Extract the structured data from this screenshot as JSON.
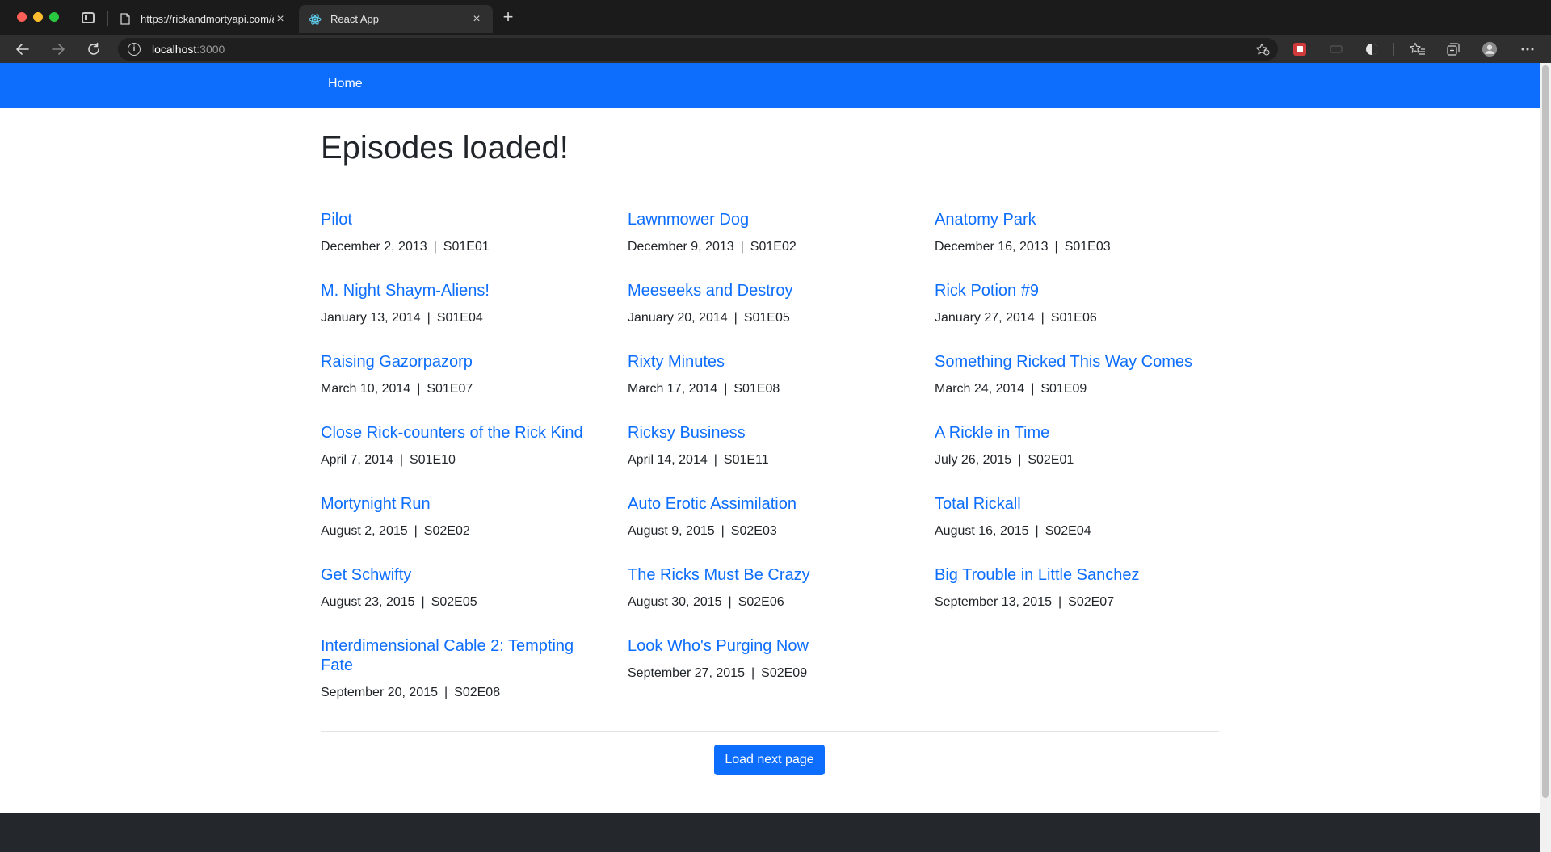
{
  "browser": {
    "tabs": [
      {
        "title": "https://rickandmortyapi.com/api/episode",
        "active": false
      },
      {
        "title": "React App",
        "active": true
      }
    ],
    "address": {
      "host": "localhost",
      "rest": ":3000"
    }
  },
  "navbar": {
    "home_label": "Home"
  },
  "page": {
    "heading": "Episodes loaded!",
    "separator": "|",
    "load_button_label": "Load next page",
    "episodes": [
      {
        "title": "Pilot",
        "date": "December 2, 2013",
        "code": "S01E01"
      },
      {
        "title": "Lawnmower Dog",
        "date": "December 9, 2013",
        "code": "S01E02"
      },
      {
        "title": "Anatomy Park",
        "date": "December 16, 2013",
        "code": "S01E03"
      },
      {
        "title": "M. Night Shaym-Aliens!",
        "date": "January 13, 2014",
        "code": "S01E04"
      },
      {
        "title": "Meeseeks and Destroy",
        "date": "January 20, 2014",
        "code": "S01E05"
      },
      {
        "title": "Rick Potion #9",
        "date": "January 27, 2014",
        "code": "S01E06"
      },
      {
        "title": "Raising Gazorpazorp",
        "date": "March 10, 2014",
        "code": "S01E07"
      },
      {
        "title": "Rixty Minutes",
        "date": "March 17, 2014",
        "code": "S01E08"
      },
      {
        "title": "Something Ricked This Way Comes",
        "date": "March 24, 2014",
        "code": "S01E09"
      },
      {
        "title": "Close Rick-counters of the Rick Kind",
        "date": "April 7, 2014",
        "code": "S01E10"
      },
      {
        "title": "Ricksy Business",
        "date": "April 14, 2014",
        "code": "S01E11"
      },
      {
        "title": "A Rickle in Time",
        "date": "July 26, 2015",
        "code": "S02E01"
      },
      {
        "title": "Mortynight Run",
        "date": "August 2, 2015",
        "code": "S02E02"
      },
      {
        "title": "Auto Erotic Assimilation",
        "date": "August 9, 2015",
        "code": "S02E03"
      },
      {
        "title": "Total Rickall",
        "date": "August 16, 2015",
        "code": "S02E04"
      },
      {
        "title": "Get Schwifty",
        "date": "August 23, 2015",
        "code": "S02E05"
      },
      {
        "title": "The Ricks Must Be Crazy",
        "date": "August 30, 2015",
        "code": "S02E06"
      },
      {
        "title": "Big Trouble in Little Sanchez",
        "date": "September 13, 2015",
        "code": "S02E07"
      },
      {
        "title": "Interdimensional Cable 2: Tempting Fate",
        "date": "September 20, 2015",
        "code": "S02E08"
      },
      {
        "title": "Look Who's Purging Now",
        "date": "September 27, 2015",
        "code": "S02E09"
      }
    ]
  },
  "colors": {
    "accent": "#0d6efd",
    "text": "#212529",
    "footer": "#24272b"
  }
}
